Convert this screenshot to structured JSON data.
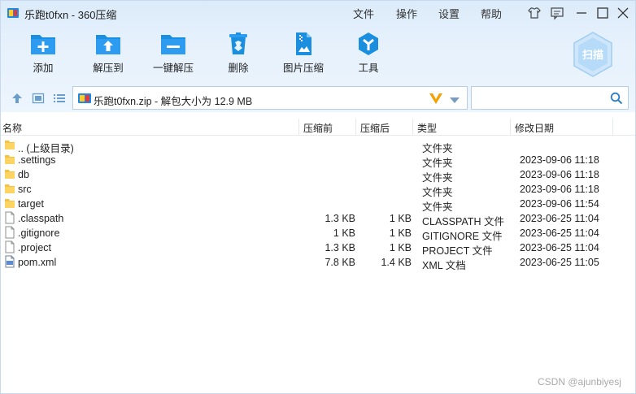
{
  "window": {
    "title": "乐跑t0fxn - 360压缩"
  },
  "menu": {
    "file": "文件",
    "operate": "操作",
    "settings": "设置",
    "help": "帮助"
  },
  "toolbar": {
    "add": "添加",
    "extract_to": "解压到",
    "one_click_extract": "一键解压",
    "delete": "删除",
    "image_compress": "图片压缩",
    "tools": "工具",
    "scan": "扫描"
  },
  "address": {
    "path": "乐跑t0fxn.zip - 解包大小为 12.9 MB"
  },
  "search": {
    "placeholder": ""
  },
  "columns": {
    "name": "名称",
    "before": "压缩前",
    "after": "压缩后",
    "type": "类型",
    "date": "修改日期"
  },
  "rows": [
    {
      "icon": "folder-icon",
      "name": ".. (上级目录)",
      "before": "",
      "after": "",
      "type": "文件夹",
      "date": ""
    },
    {
      "icon": "folder-icon",
      "name": ".settings",
      "before": "",
      "after": "",
      "type": "文件夹",
      "date": "2023-09-06 11:18"
    },
    {
      "icon": "folder-icon",
      "name": "db",
      "before": "",
      "after": "",
      "type": "文件夹",
      "date": "2023-09-06 11:18"
    },
    {
      "icon": "folder-icon",
      "name": "src",
      "before": "",
      "after": "",
      "type": "文件夹",
      "date": "2023-09-06 11:18"
    },
    {
      "icon": "folder-icon",
      "name": "target",
      "before": "",
      "after": "",
      "type": "文件夹",
      "date": "2023-09-06 11:54"
    },
    {
      "icon": "file-icon",
      "name": ".classpath",
      "before": "1.3 KB",
      "after": "1 KB",
      "type": "CLASSPATH 文件",
      "date": "2023-06-25 11:04"
    },
    {
      "icon": "file-icon",
      "name": ".gitignore",
      "before": "1 KB",
      "after": "1 KB",
      "type": "GITIGNORE 文件",
      "date": "2023-06-25 11:04"
    },
    {
      "icon": "file-icon",
      "name": ".project",
      "before": "1.3 KB",
      "after": "1 KB",
      "type": "PROJECT 文件",
      "date": "2023-06-25 11:04"
    },
    {
      "icon": "xml-file-icon",
      "name": "pom.xml",
      "before": "7.8 KB",
      "after": "1.4 KB",
      "type": "XML 文档",
      "date": "2023-06-25 11:05"
    }
  ],
  "watermark": "CSDN @ajunbiyesj",
  "colors": {
    "accent": "#1a8fe0",
    "header_bg": "#e3effb",
    "folder": "#f5c242"
  }
}
